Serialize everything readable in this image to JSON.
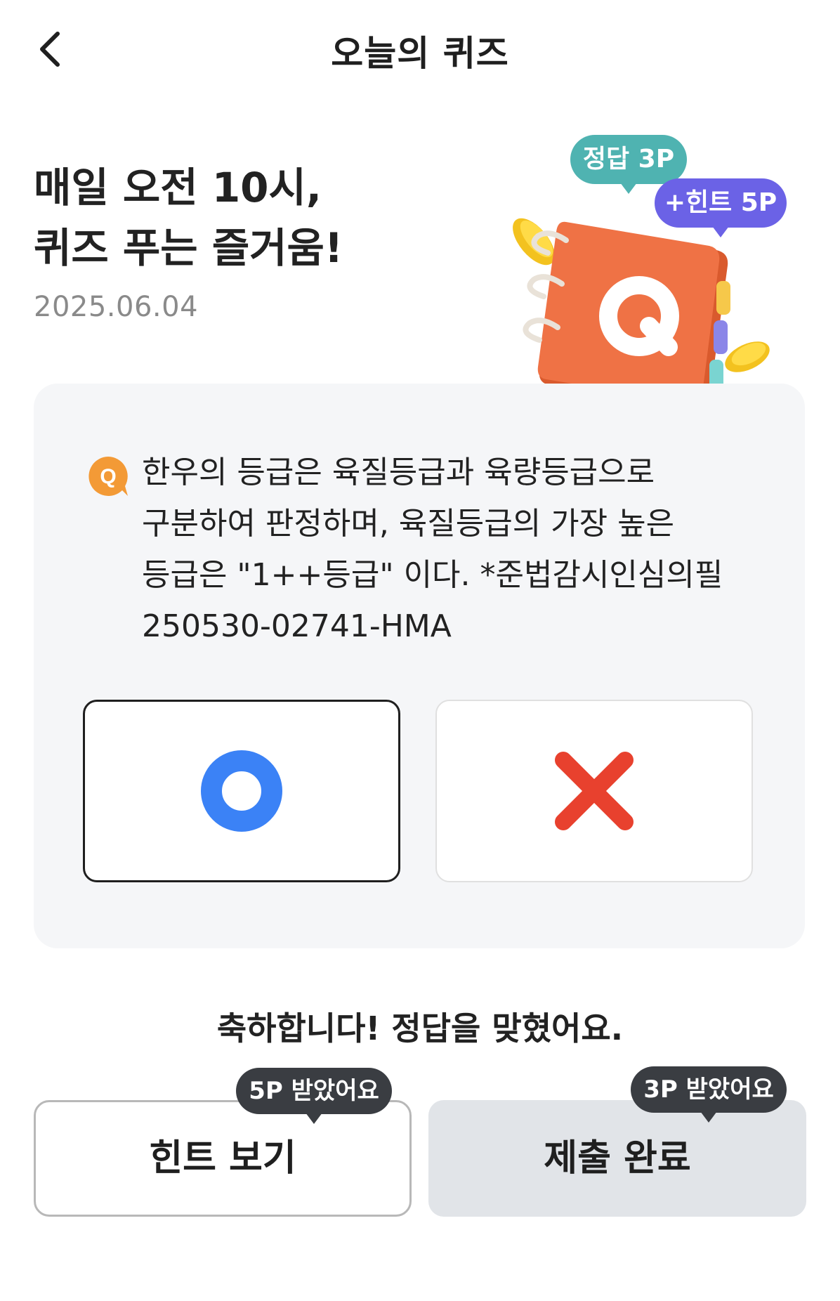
{
  "header": {
    "title": "오늘의 퀴즈"
  },
  "hero": {
    "title_line1": "매일 오전 10시,",
    "title_line2": "퀴즈 푸는 즐거움!",
    "date": "2025.06.04",
    "answer_bubble": "정답 3P",
    "hint_bubble": "+힌트 5P",
    "illustration_letter": "Q"
  },
  "quiz": {
    "q_badge": "Q",
    "question": "한우의 등급은 육질등급과 육량등급으로 구분하여 판정하며, 육질등급의 가장 높은 등급은 \"1++등급\" 이다. *준법감시인심의필 250530-02741-HMA",
    "options": [
      {
        "name": "O",
        "selected": true
      },
      {
        "name": "X",
        "selected": false
      }
    ]
  },
  "result": {
    "message": "축하합니다! 정답을 맞혔어요."
  },
  "buttons": {
    "hint_label": "힌트 보기",
    "hint_reward": "5P 받았어요",
    "submit_label": "제출 완료",
    "submit_reward": "3P 받았어요"
  },
  "colors": {
    "o_blue": "#3b82f6",
    "x_red": "#e8412e",
    "answer_bubble": "#4fb3b1",
    "hint_bubble": "#6b62e6",
    "notebook_orange": "#ef7245",
    "q_badge_orange": "#f39a36"
  }
}
